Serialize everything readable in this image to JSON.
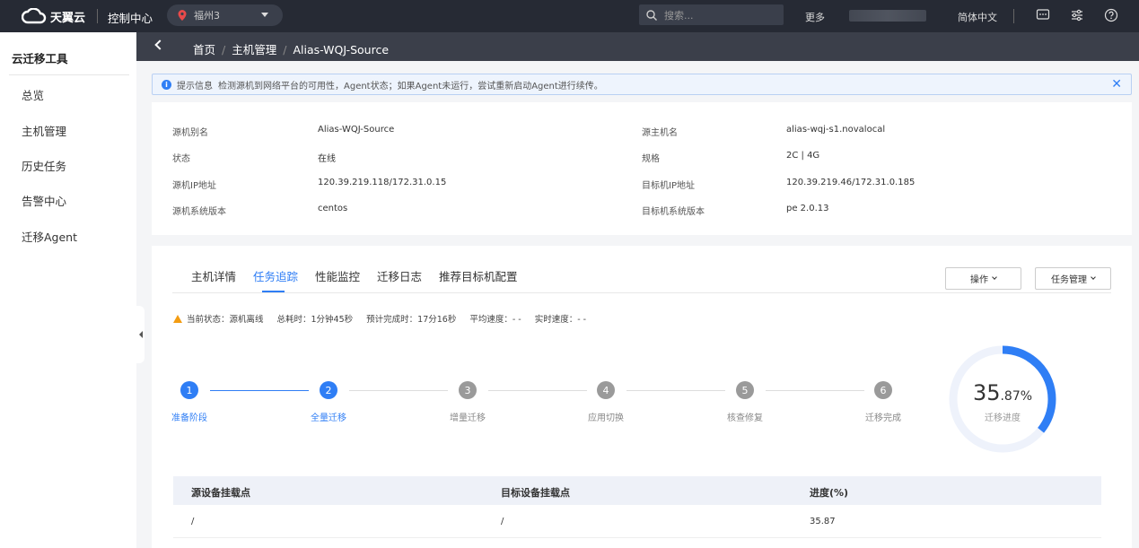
{
  "topbar": {
    "logo_text": "天翼云",
    "console": "控制中心",
    "region": "福州3",
    "search_placeholder": "搜索...",
    "more": "更多",
    "language": "简体中文"
  },
  "sidebar": {
    "title": "云迁移工具",
    "items": [
      {
        "label": "总览"
      },
      {
        "label": "主机管理"
      },
      {
        "label": "历史任务"
      },
      {
        "label": "告警中心"
      },
      {
        "label": "迁移Agent"
      }
    ]
  },
  "breadcrumb": {
    "home": "首页",
    "host_mgmt": "主机管理",
    "current": "Alias-WQJ-Source"
  },
  "alert": {
    "title": "提示信息",
    "text": "检测源机到网络平台的可用性，Agent状态；如果Agent未运行，尝试重新启动Agent进行续传。"
  },
  "host_info": {
    "left": [
      {
        "label": "源机别名",
        "value": "Alias-WQJ-Source"
      },
      {
        "label": "状态",
        "value": "在线"
      },
      {
        "label": "源机IP地址",
        "value": "120.39.219.118/172.31.0.15"
      },
      {
        "label": "源机系统版本",
        "value": "centos"
      }
    ],
    "right": [
      {
        "label": "源主机名",
        "value": "alias-wqj-s1.novalocal"
      },
      {
        "label": "规格",
        "value": "2C | 4G"
      },
      {
        "label": "目标机IP地址",
        "value": "120.39.219.46/172.31.0.185"
      },
      {
        "label": "目标机系统版本",
        "value": "pe 2.0.13"
      }
    ]
  },
  "tabs": [
    {
      "label": "主机详情",
      "active": false
    },
    {
      "label": "任务追踪",
      "active": true
    },
    {
      "label": "性能监控",
      "active": false
    },
    {
      "label": "迁移日志",
      "active": false
    },
    {
      "label": "推荐目标机配置",
      "active": false
    }
  ],
  "actions": {
    "operate": "操作",
    "task_mgmt": "任务管理"
  },
  "status": {
    "current": "当前状态：源机离线",
    "elapsed": "总耗时：1分钟45秒",
    "eta": "预计完成时：17分16秒",
    "avg_speed": "平均速度：- -",
    "rt_speed": "实时速度：- -"
  },
  "steps": [
    {
      "num": "1",
      "label": "准备阶段",
      "done": true
    },
    {
      "num": "2",
      "label": "全量迁移",
      "done": true
    },
    {
      "num": "3",
      "label": "增量迁移",
      "done": false
    },
    {
      "num": "4",
      "label": "应用切换",
      "done": false
    },
    {
      "num": "5",
      "label": "核查修复",
      "done": false
    },
    {
      "num": "6",
      "label": "迁移完成",
      "done": false
    }
  ],
  "progress": {
    "int": "35",
    "dec": ".87%",
    "value": 35.87,
    "label": "迁移进度",
    "color": "#2f7ef5",
    "track_color": "#eef2fb"
  },
  "table": {
    "headers": [
      "源设备挂载点",
      "目标设备挂载点",
      "进度(%)"
    ],
    "rows": [
      [
        "/",
        "/",
        "35.87"
      ]
    ]
  }
}
